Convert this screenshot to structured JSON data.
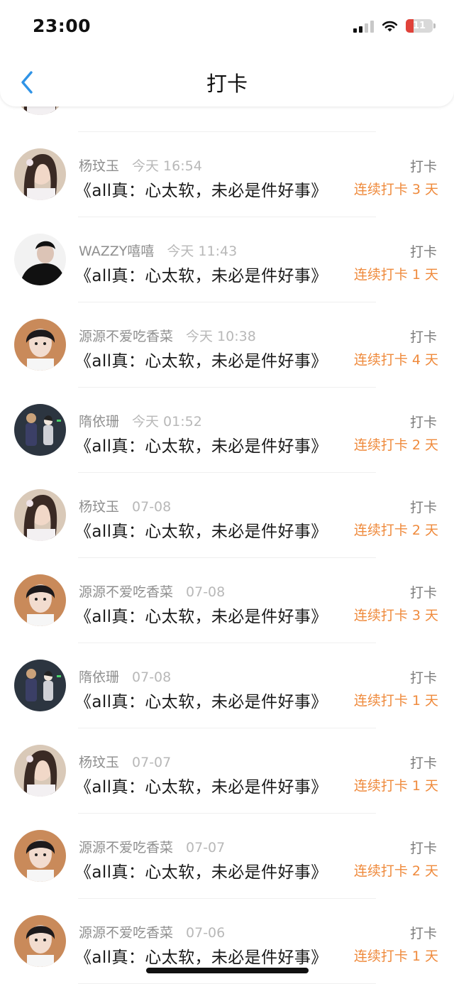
{
  "status_bar": {
    "time": "23:00",
    "battery": "11"
  },
  "header": {
    "title": "打卡"
  },
  "colors": {
    "streak": "#ef8a3c",
    "back": "#2f93e6"
  },
  "rows": [
    {
      "name": "",
      "date": "",
      "book": "",
      "tag": "",
      "streak": "",
      "avatar": "girl"
    },
    {
      "name": "杨玟玉",
      "date": "今天 16:54",
      "book": "《all真：心太软，未必是件好事》",
      "tag": "打卡",
      "streak": "连续打卡 3 天",
      "avatar": "girl"
    },
    {
      "name": "WAZZY嘻嘻",
      "date": "今天 11:43",
      "book": "《all真：心太软，未必是件好事》",
      "tag": "打卡",
      "streak": "连续打卡 1 天",
      "avatar": "man-black"
    },
    {
      "name": "源源不爱吃香菜",
      "date": "今天 10:38",
      "book": "《all真：心太软，未必是件好事》",
      "tag": "打卡",
      "streak": "连续打卡 4 天",
      "avatar": "boy"
    },
    {
      "name": "隋依珊",
      "date": "今天 01:52",
      "book": "《all真：心太软，未必是件好事》",
      "tag": "打卡",
      "streak": "连续打卡 2 天",
      "avatar": "anime"
    },
    {
      "name": "杨玟玉",
      "date": "07-08",
      "book": "《all真：心太软，未必是件好事》",
      "tag": "打卡",
      "streak": "连续打卡 2 天",
      "avatar": "girl"
    },
    {
      "name": "源源不爱吃香菜",
      "date": "07-08",
      "book": "《all真：心太软，未必是件好事》",
      "tag": "打卡",
      "streak": "连续打卡 3 天",
      "avatar": "boy"
    },
    {
      "name": "隋依珊",
      "date": "07-08",
      "book": "《all真：心太软，未必是件好事》",
      "tag": "打卡",
      "streak": "连续打卡 1 天",
      "avatar": "anime"
    },
    {
      "name": "杨玟玉",
      "date": "07-07",
      "book": "《all真：心太软，未必是件好事》",
      "tag": "打卡",
      "streak": "连续打卡 1 天",
      "avatar": "girl"
    },
    {
      "name": "源源不爱吃香菜",
      "date": "07-07",
      "book": "《all真：心太软，未必是件好事》",
      "tag": "打卡",
      "streak": "连续打卡 2 天",
      "avatar": "boy"
    },
    {
      "name": "源源不爱吃香菜",
      "date": "07-06",
      "book": "《all真：心太软，未必是件好事》",
      "tag": "打卡",
      "streak": "连续打卡 1 天",
      "avatar": "boy"
    }
  ]
}
